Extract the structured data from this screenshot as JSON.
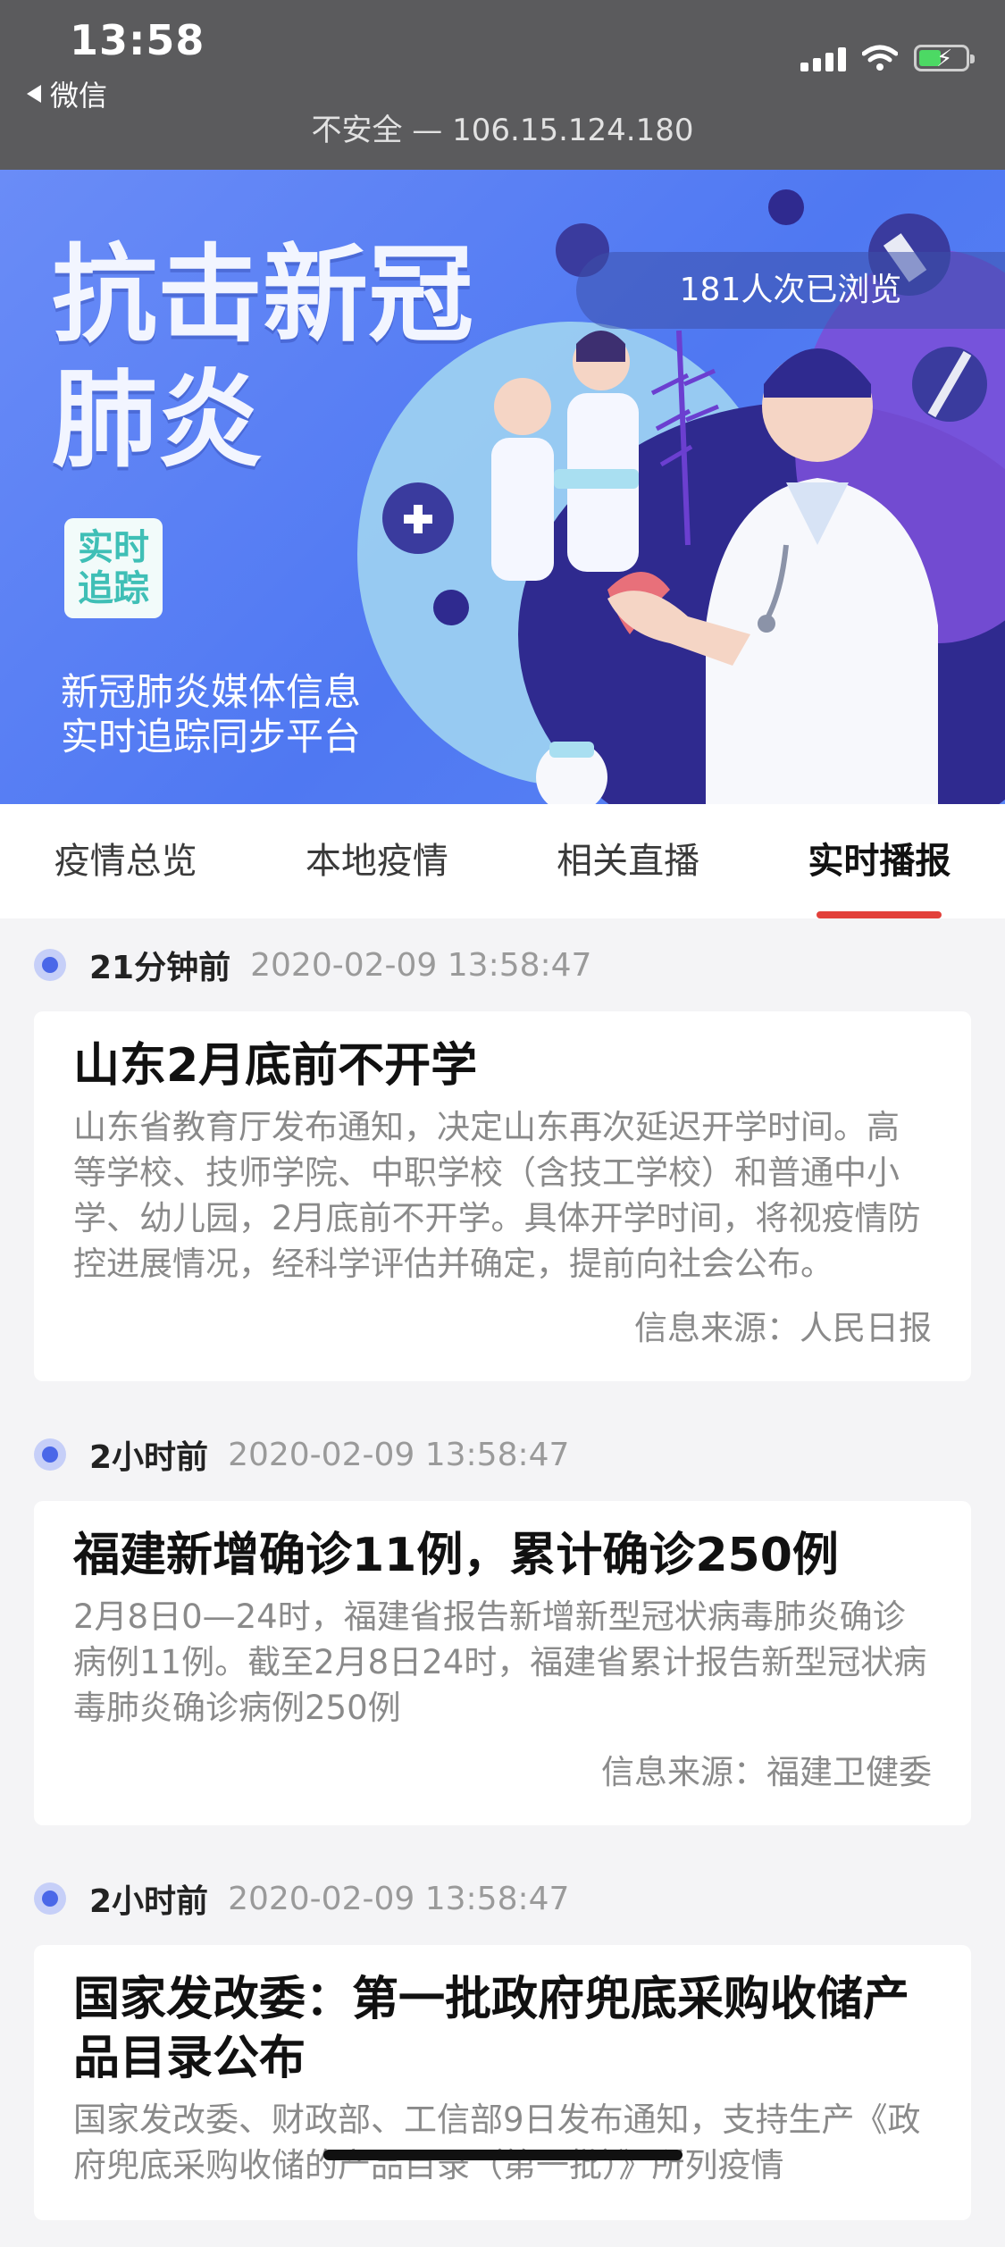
{
  "status": {
    "time": "13:58",
    "back_label": "微信",
    "url": "不安全 — 106.15.124.180"
  },
  "banner": {
    "title_line1": "抗击新冠",
    "title_line2": "肺炎",
    "tag_line1": "实时",
    "tag_line2": "追踪",
    "subtitle_line1": "新冠肺炎媒体信息",
    "subtitle_line2": "实时追踪同步平台",
    "views": "181人次已浏览"
  },
  "tabs": [
    {
      "label": "疫情总览",
      "active": false
    },
    {
      "label": "本地疫情",
      "active": false
    },
    {
      "label": "相关直播",
      "active": false
    },
    {
      "label": "实时播报",
      "active": true
    }
  ],
  "feed": [
    {
      "ago": "21分钟前",
      "time": "2020-02-09 13:58:47",
      "title": "山东2月底前不开学",
      "body": "山东省教育厅发布通知，决定山东再次延迟开学时间。高等学校、技师学院、中职学校（含技工学校）和普通中小学、幼儿园，2月底前不开学。具体开学时间，将视疫情防控进展情况，经科学评估并确定，提前向社会公布。",
      "source": "信息来源：人民日报"
    },
    {
      "ago": "2小时前",
      "time": "2020-02-09 13:58:47",
      "title": "福建新增确诊11例，累计确诊250例",
      "body": "2月8日0—24时，福建省报告新增新型冠状病毒肺炎确诊病例11例。截至2月8日24时，福建省累计报告新型冠状病毒肺炎确诊病例250例",
      "source": "信息来源：福建卫健委"
    },
    {
      "ago": "2小时前",
      "time": "2020-02-09 13:58:47",
      "title": "国家发改委：第一批政府兜底采购收储产品目录公布",
      "body": "国家发改委、财政部、工信部9日发布通知，支持生产《政府兜底采购收储的产品目录（第一批）》所列疫情",
      "source": ""
    }
  ],
  "colors": {
    "accent": "#e2413b",
    "banner": "#5a7ff3",
    "dot": "#4a67e8"
  }
}
